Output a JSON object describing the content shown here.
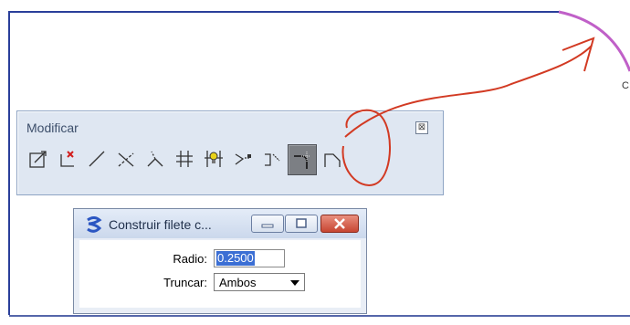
{
  "colors": {
    "frame_line": "#2a3f9a",
    "annotation_red": "#d23a23",
    "arc_purple": "#c060c8"
  },
  "side_label": "C",
  "toolbar": {
    "title": "Modificar",
    "close_glyph": "⊠",
    "tools": [
      {
        "icon": "modify-element-icon"
      },
      {
        "icon": "partial-delete-icon"
      },
      {
        "icon": "extend-line-icon"
      },
      {
        "icon": "extend-two-elements-icon"
      },
      {
        "icon": "extend-to-intersection-icon"
      },
      {
        "icon": "trim-multiple-icon"
      },
      {
        "icon": "intellitrim-icon"
      },
      {
        "icon": "insert-vertex-icon"
      },
      {
        "icon": "delete-vertex-icon"
      },
      {
        "icon": "construct-fillet-icon",
        "active": true
      },
      {
        "icon": "construct-chamfer-icon"
      }
    ]
  },
  "dialog": {
    "title": "Construir filete c...",
    "radio_label": "Radio:",
    "radio_value": "0.2500",
    "truncar_label": "Truncar:",
    "truncar_value": "Ambos"
  }
}
